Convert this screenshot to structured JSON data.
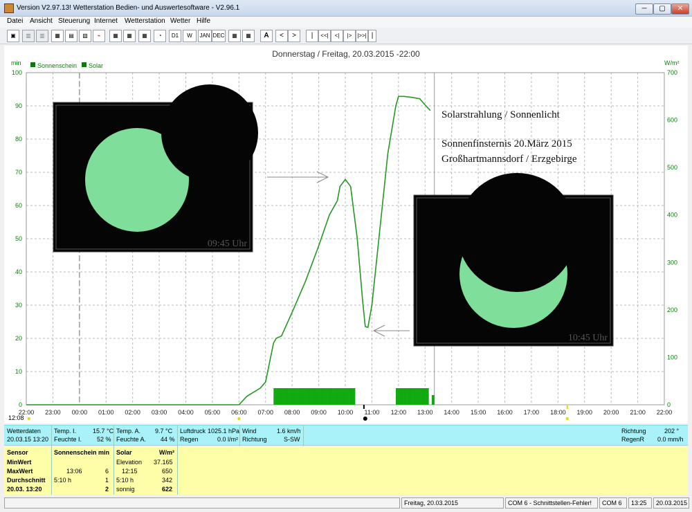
{
  "window": {
    "title": "Version V2.97.13!  Wetterstation Bedien- und Auswertesoftware - V2.96.1",
    "controls": [
      "─",
      "▢",
      "✕"
    ]
  },
  "menu": [
    "Datei",
    "Ansicht",
    "Steuerung",
    "Internet",
    "Wetterstation",
    "Wetter",
    "Hilfe"
  ],
  "toolbar": {
    "buttons": [
      "▣",
      "▥",
      "▥",
      "▦",
      "▤",
      "▧",
      "⌁",
      "▦",
      "▦",
      "▦",
      "◔",
      "D1",
      "W",
      "JAN",
      "DEC",
      "▦",
      "▦",
      "A",
      "<",
      ">",
      "|",
      "<<|",
      "<|",
      "|>",
      "|>>|",
      "|"
    ]
  },
  "chart": {
    "title": "Donnerstag / Freitag, 20.03.2015  -22:00",
    "left_unit": "min",
    "right_unit": "W/m²",
    "legend": [
      "Sonnenschein",
      "Solar"
    ],
    "left_ticks": [
      "0",
      "10",
      "20",
      "30",
      "40",
      "50",
      "60",
      "70",
      "80",
      "90",
      "100"
    ],
    "right_ticks": [
      "0",
      "100",
      "200",
      "300",
      "400",
      "500",
      "600",
      "700"
    ],
    "x_ticks": [
      "22:00",
      "23:00",
      "00:00",
      "01:00",
      "02:00",
      "03:00",
      "04:00",
      "05:00",
      "06:00",
      "07:00",
      "08:00",
      "09:00",
      "10:00",
      "11:00",
      "12:00",
      "13:00",
      "14:00",
      "15:00",
      "16:00",
      "17:00",
      "18:00",
      "19:00",
      "20:00",
      "21:00",
      "22:00"
    ],
    "bottom_time": "12:08",
    "annotation_lines": [
      "Solarstrahlung / Sonnenlicht",
      "Sonnenfinsternis 20.März 2015",
      "Großhartmannsdorf / Erzgebirge"
    ],
    "photo1_label": "09:45 Uhr",
    "photo2_label": "10:45 Uhr",
    "colors": {
      "series": "#229922",
      "bars": "#11aa11",
      "photo_bg": "#050505",
      "sun": "#7fdf9a"
    }
  },
  "chart_data": {
    "type": "line",
    "x_unit": "hour",
    "series": [
      {
        "name": "Solar",
        "axis": "right",
        "x": [
          6.0,
          6.3,
          6.8,
          7.0,
          7.3,
          7.4,
          7.6,
          8.0,
          8.5,
          9.0,
          9.4,
          9.7,
          9.8,
          10.0,
          10.2,
          10.45,
          10.65,
          10.75,
          10.85,
          11.0,
          11.3,
          11.6,
          11.9,
          12.0,
          12.2,
          12.5,
          12.8,
          13.0,
          13.2
        ],
        "y": [
          0,
          18,
          35,
          48,
          130,
          140,
          145,
          195,
          260,
          335,
          400,
          430,
          460,
          475,
          460,
          350,
          220,
          165,
          163,
          210,
          370,
          530,
          630,
          650,
          650,
          648,
          645,
          632,
          620
        ]
      }
    ],
    "bars": {
      "name": "Sonnenschein",
      "axis": "left",
      "ranges": [
        [
          7.3,
          10.35
        ],
        [
          11.9,
          13.1
        ]
      ],
      "value": 5
    },
    "left_ylim": [
      0,
      100
    ],
    "right_ylim": [
      0,
      700
    ],
    "xlim": [
      22,
      46
    ]
  },
  "info": {
    "wetterdaten": "Wetterdaten",
    "datetime": "20.03.15 13:20",
    "temp_i_label": "Temp. I.",
    "temp_i": "15.7 °C",
    "feuchte_i_label": "Feuchte I.",
    "feuchte_i": "52 %",
    "temp_a_label": "Temp. A.",
    "temp_a": "9.7 °C",
    "feuchte_a_label": "Feuchte A.",
    "feuchte_a": "44 %",
    "luftdruck_label": "Luftdruck",
    "luftdruck": "1025.1 hPa",
    "regen_label": "Regen",
    "regen": "0.0 l/m²",
    "wind_label": "Wind",
    "wind": "1.6 km/h",
    "richtung_label": "Richtung",
    "richtung": "S-SW",
    "richtung2_label": "Richtung",
    "richtung2": "202 °",
    "regenr_label": "RegenR",
    "regenr": "0.0 mm/h"
  },
  "stats": {
    "sensor_col": [
      "Sensor",
      "MinWert",
      "MaxWert",
      "Durchschnitt",
      "20.03. 13:20"
    ],
    "sonne_header": "Sonnenschein min",
    "sonne_rows": [
      [
        "",
        ""
      ],
      [
        "13:06",
        "6"
      ],
      [
        "5:10 h",
        "1"
      ],
      [
        "",
        "2"
      ]
    ],
    "solar_header": "Solar",
    "solar_unit": "W/m²",
    "solar_rows": [
      [
        "Elevation",
        "37.165"
      ],
      [
        "12:15",
        "650"
      ],
      [
        "5:10 h",
        "342"
      ],
      [
        "sonnig",
        "622"
      ]
    ]
  },
  "status": [
    "Freitag, 20.03.2015",
    "COM 6 - Schnittstellen-Fehler!",
    "COM 6",
    "13:25",
    "20.03.2015"
  ]
}
